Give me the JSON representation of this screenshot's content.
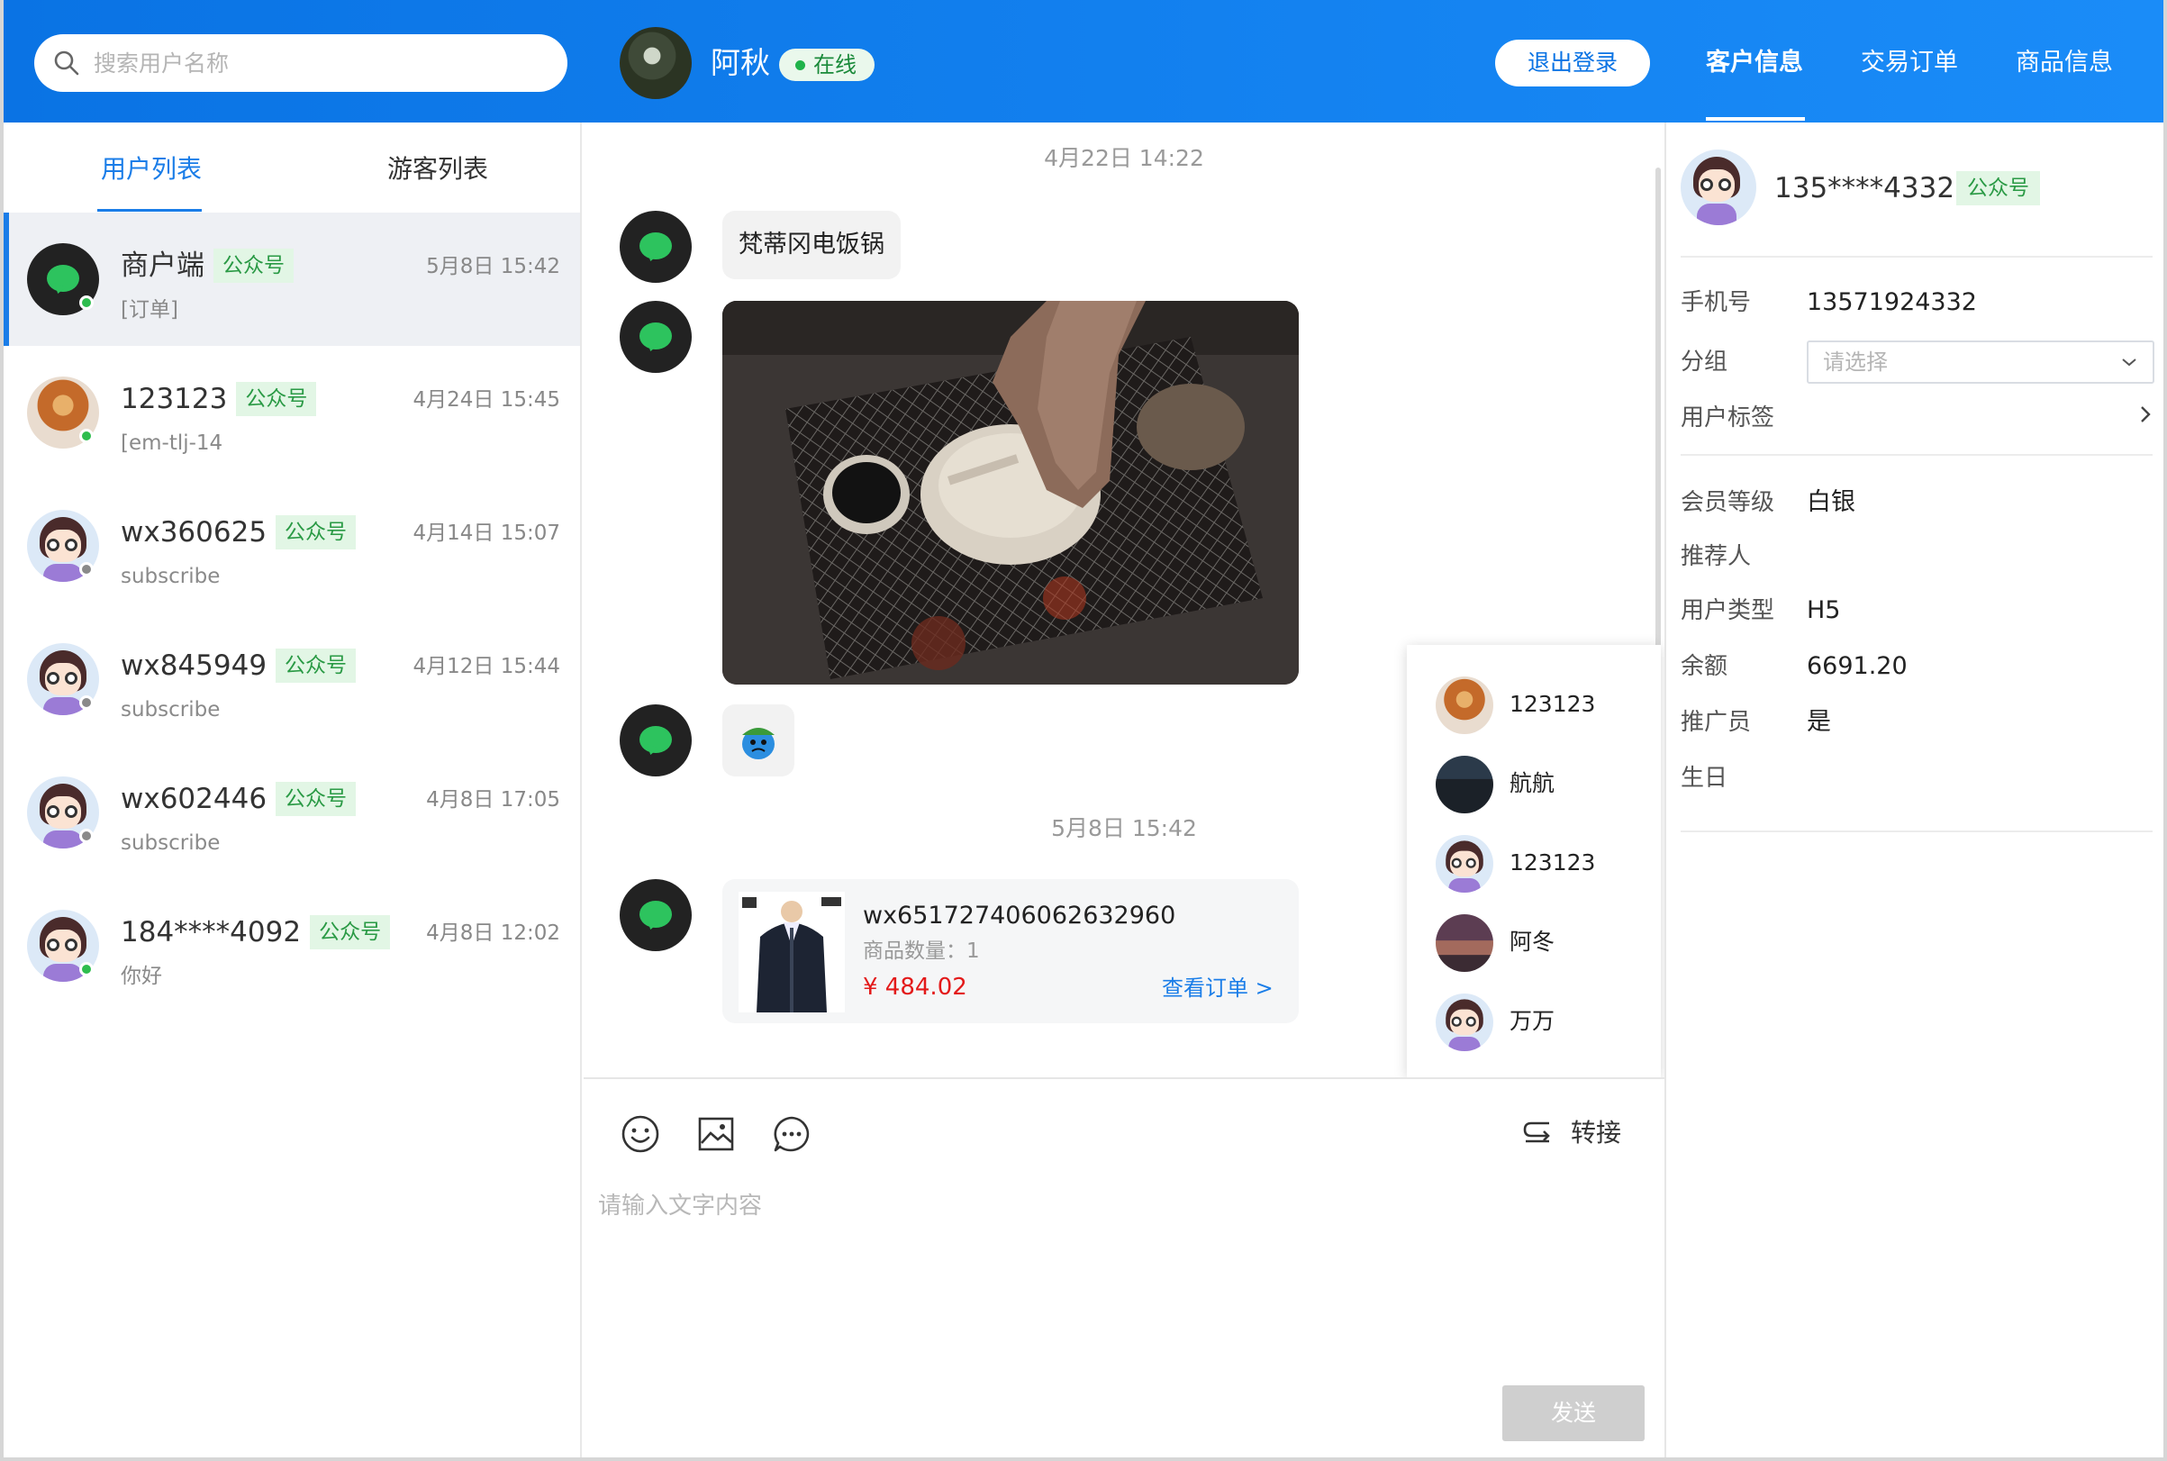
{
  "header": {
    "search_placeholder": "搜索用户名称",
    "agent_name": "阿秋",
    "agent_status": "在线",
    "logout_label": "退出登录",
    "tabs": [
      {
        "label": "客户信息",
        "active": true
      },
      {
        "label": "交易订单",
        "active": false
      },
      {
        "label": "商品信息",
        "active": false
      }
    ]
  },
  "sidebar": {
    "tabs": [
      {
        "label": "用户列表",
        "active": true
      },
      {
        "label": "游客列表",
        "active": false
      }
    ],
    "users": [
      {
        "name": "商户端",
        "badge": "公众号",
        "time": "5月8日 15:42",
        "last_msg": "[订单]",
        "online": true,
        "avatar": "wechat-icon",
        "selected": true
      },
      {
        "name": "123123",
        "badge": "公众号",
        "time": "4月24日 15:45",
        "last_msg": "[em-tlj-14",
        "online": true,
        "avatar": "photo-avatar",
        "selected": false
      },
      {
        "name": "wx360625",
        "badge": "公众号",
        "time": "4月14日 15:07",
        "last_msg": "subscribe",
        "online": false,
        "avatar": "default-avatar",
        "selected": false
      },
      {
        "name": "wx845949",
        "badge": "公众号",
        "time": "4月12日 15:44",
        "last_msg": "subscribe",
        "online": false,
        "avatar": "default-avatar",
        "selected": false
      },
      {
        "name": "wx602446",
        "badge": "公众号",
        "time": "4月8日 17:05",
        "last_msg": "subscribe",
        "online": false,
        "avatar": "default-avatar",
        "selected": false
      },
      {
        "name": "184****4092",
        "badge": "公众号",
        "time": "4月8日 12:02",
        "last_msg": "你好",
        "online": true,
        "avatar": "default-avatar",
        "selected": false
      }
    ]
  },
  "chat": {
    "time_1": "4月22日 14:22",
    "msg_text": "梵蒂冈电饭锅",
    "time_2": "5月8日 15:42",
    "order": {
      "id": "wx651727406062632960",
      "qty_label": "商品数量：",
      "qty": "1",
      "price": "¥ 484.02",
      "link": "查看订单 >"
    }
  },
  "transfer_popup": {
    "agents": [
      {
        "name": "123123",
        "avatar": "photo-avatar"
      },
      {
        "name": "航航",
        "avatar": "photo-avatar"
      },
      {
        "name": "123123",
        "avatar": "default-avatar"
      },
      {
        "name": "阿冬",
        "avatar": "photo-avatar"
      },
      {
        "name": "万万",
        "avatar": "default-avatar"
      }
    ]
  },
  "composer": {
    "transfer_label": "转接",
    "placeholder": "请输入文字内容",
    "send_label": "发送",
    "tools": [
      "smile-icon",
      "image-icon",
      "chat-dots-icon"
    ]
  },
  "customer": {
    "name": "135****4332",
    "badge": "公众号",
    "fields": [
      {
        "label": "手机号",
        "value": "13571924332"
      },
      {
        "label": "分组",
        "value": "请选择"
      },
      {
        "label": "用户标签",
        "value": ""
      },
      {
        "label": "会员等级",
        "value": "白银"
      },
      {
        "label": "推荐人",
        "value": ""
      },
      {
        "label": "用户类型",
        "value": "H5"
      },
      {
        "label": "余额",
        "value": "6691.20"
      },
      {
        "label": "推广员",
        "value": "是"
      },
      {
        "label": "生日",
        "value": ""
      }
    ]
  },
  "colors": {
    "header_blue": "#0a73e4",
    "accent_blue": "#1a7de8",
    "badge_green": "#2a9a45",
    "price_red": "#e31a1a",
    "online_green": "#2ebd4e"
  }
}
